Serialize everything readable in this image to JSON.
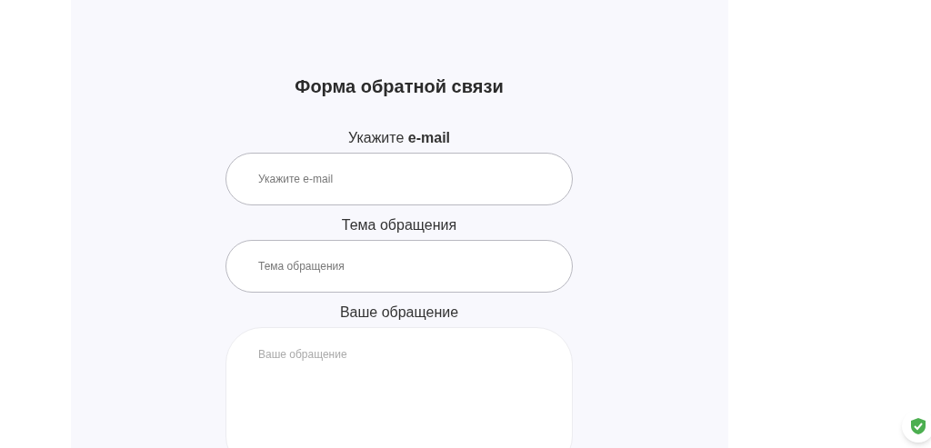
{
  "form": {
    "title": "Форма обратной связи",
    "fields": [
      {
        "kind": "input",
        "label": "Укажите **e-mail**",
        "placeholder": "Укажите e-mail"
      },
      {
        "kind": "input",
        "label": "Тема обращения",
        "placeholder": "Тема обращения"
      },
      {
        "kind": "textarea",
        "label": "Ваше обращение",
        "placeholder": "Ваше обращение"
      }
    ]
  }
}
